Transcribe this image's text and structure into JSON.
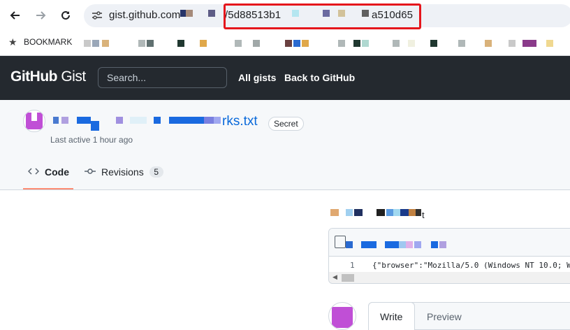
{
  "browser": {
    "url_prefix": "gist.github.com",
    "url_middle": "/5d88513b1",
    "url_suffix": "a510d65",
    "bookmark_label": "BOOKMARK"
  },
  "header": {
    "logo_bold": "GitHub",
    "logo_light": " Gist",
    "search_placeholder": "Search...",
    "nav_links": [
      "All gists",
      "Back to GitHub"
    ]
  },
  "gist": {
    "title_visible": "rks.txt",
    "visibility_badge": "Secret",
    "last_active": "Last active 1 hour ago",
    "tabs": [
      {
        "label": "Code",
        "icon": "code-icon"
      },
      {
        "label": "Revisions",
        "icon": "commit-icon",
        "count": "5"
      }
    ]
  },
  "file": {
    "name_visible_end": "t",
    "line_number": "1",
    "code_line": "{\"browser\":\"Mozilla/5.0 (Windows NT 10.0; W"
  },
  "comment": {
    "write_tab": "Write",
    "preview_tab": "Preview"
  },
  "colors": {
    "header_bg": "#24292f",
    "link_blue": "#0969da",
    "redaction_box": "#e5161c",
    "tab_underline": "#fd8c73"
  }
}
